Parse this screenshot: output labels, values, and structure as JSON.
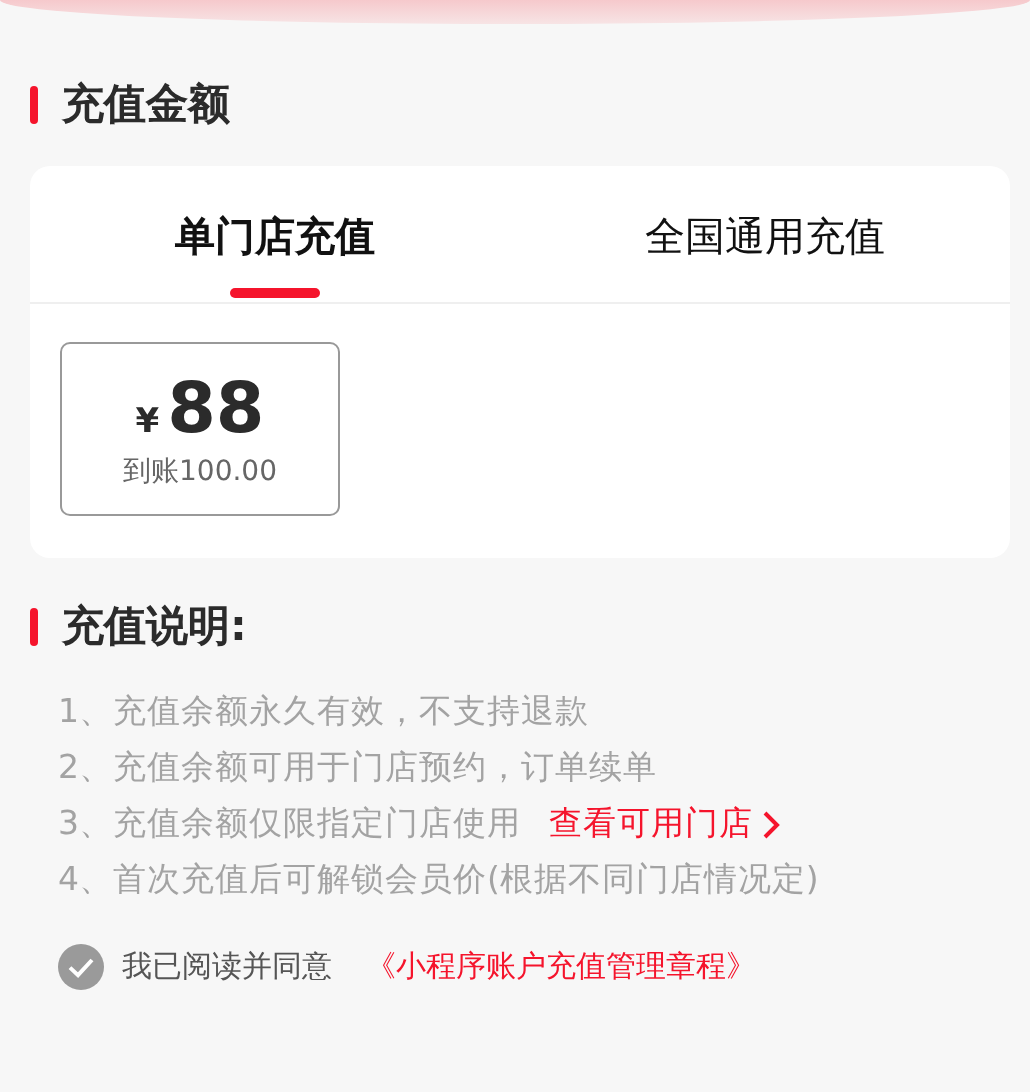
{
  "amount_section": {
    "title": "充值金额"
  },
  "tabs": [
    {
      "label": "单门店充值",
      "selected": true
    },
    {
      "label": "全国通用充值",
      "selected": false
    }
  ],
  "options": [
    {
      "currency": "¥",
      "price": "88",
      "credit": "到账100.00",
      "selected": false
    }
  ],
  "notes_section": {
    "title": "充值说明:",
    "notes": [
      {
        "text": "1、充值余额永久有效，不支持退款"
      },
      {
        "text": "2、充值余额可用于门店预约，订单续单"
      },
      {
        "text": "3、充值余额仅限指定门店使用",
        "link": "查看可用门店"
      },
      {
        "text": "4、首次充值后可解锁会员价(根据不同门店情况定)"
      }
    ]
  },
  "agreement": {
    "checked": false,
    "text": "我已阅读并同意",
    "link": "《小程序账户充值管理章程》"
  }
}
